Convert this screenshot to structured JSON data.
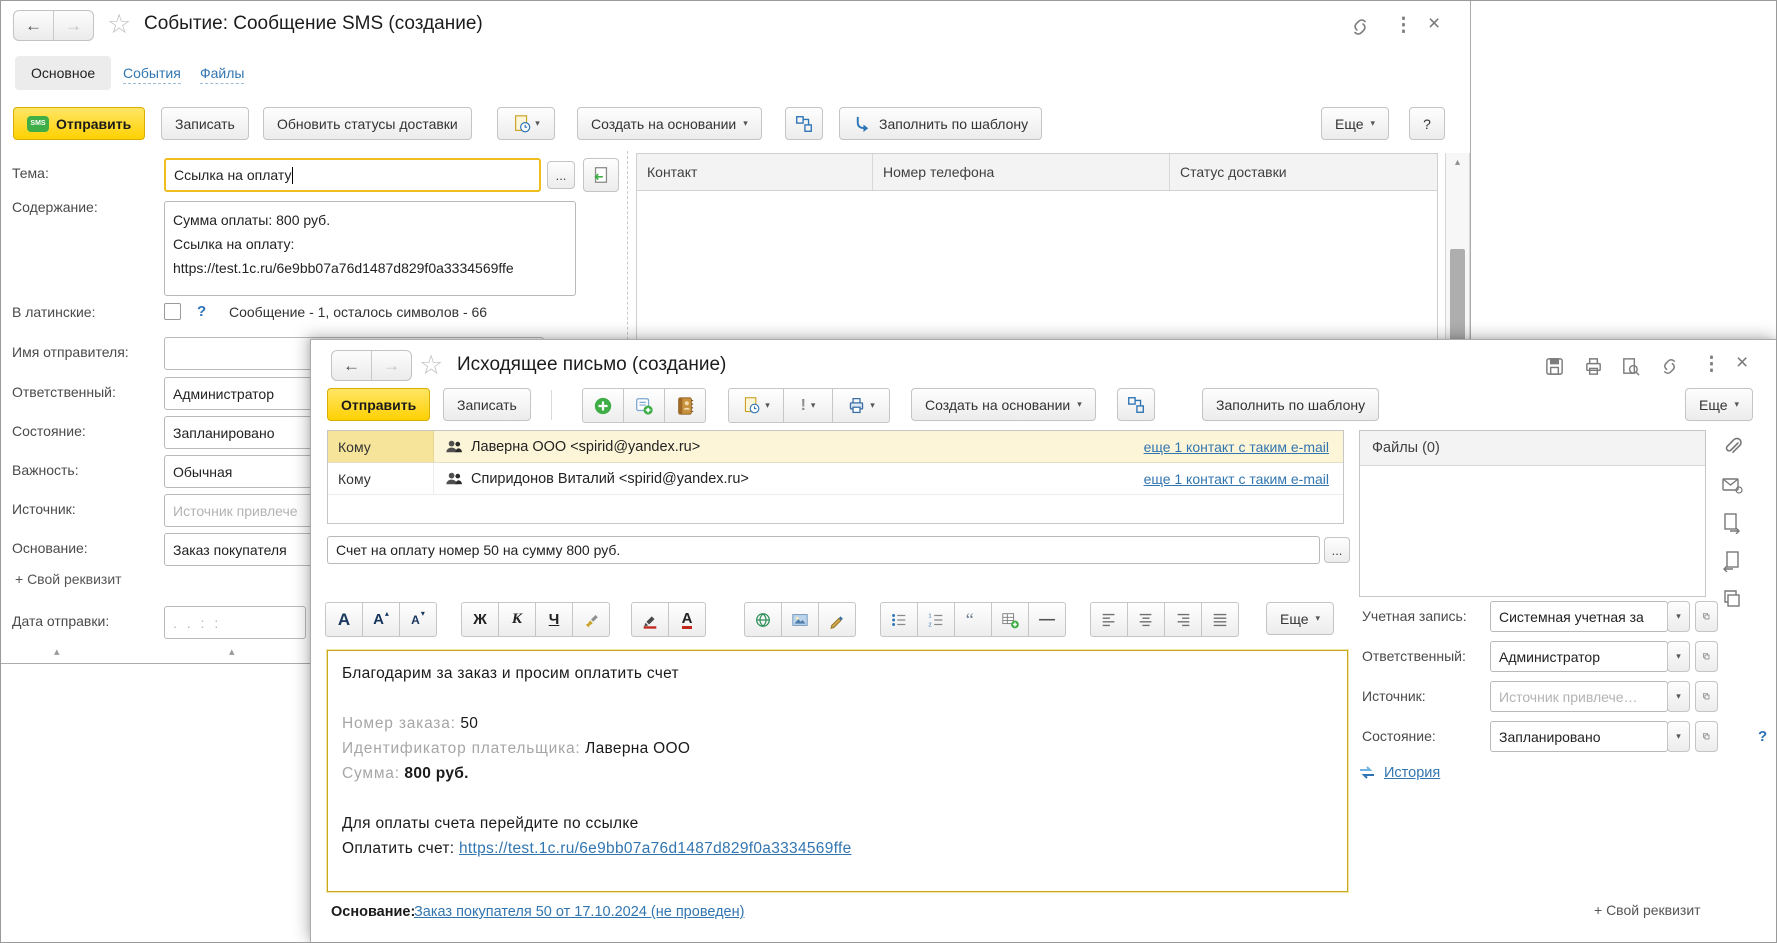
{
  "sms": {
    "title": "Событие: Сообщение SMS (создание)",
    "tabs": [
      "Основное",
      "События",
      "Файлы"
    ],
    "toolbar": {
      "send": "Отправить",
      "send_badge": "SMS",
      "save": "Записать",
      "update_status": "Обновить статусы доставки",
      "create_from": "Создать на основании",
      "fill_template": "Заполнить по шаблону",
      "more": "Еще",
      "help": "?"
    },
    "form": {
      "theme_label": "Тема:",
      "theme_value": "Ссылка на оплату",
      "ellipsis": "...",
      "content_label": "Содержание:",
      "content_value": "Сумма оплаты: 800 руб.\nСсылка на оплату:\nhttps://test.1c.ru/6e9bb07a76d1487d829f0a3334569ffe",
      "latin_label": "В латинские:",
      "latin_help": "?",
      "latin_info": "Сообщение - 1, осталось символов - 66",
      "sender_label": "Имя отправителя:",
      "responsible_label": "Ответственный:",
      "responsible_value": "Администратор",
      "state_label": "Состояние:",
      "state_value": "Запланировано",
      "importance_label": "Важность:",
      "importance_value": "Обычная",
      "source_label": "Источник:",
      "source_placeholder": "Источник привлече",
      "base_label": "Основание:",
      "base_value": "Заказ покупателя",
      "custom_attribute": "+ Свой реквизит",
      "send_date_label": "Дата отправки:",
      "send_date_placeholder": ". .     : :"
    },
    "contacts": {
      "col_contact": "Контакт",
      "col_phone": "Номер телефона",
      "col_status": "Статус доставки"
    }
  },
  "email": {
    "title": "Исходящее письмо (создание)",
    "toolbar": {
      "send": "Отправить",
      "save": "Записать",
      "create_from": "Создать на основании",
      "fill_template": "Заполнить по шаблону",
      "more": "Еще"
    },
    "recipients": [
      {
        "role": "Кому",
        "contact": "Лаверна ООО <spirid@yandex.ru>",
        "alt": "еще 1 контакт с таким e-mail"
      },
      {
        "role": "Кому",
        "contact": "Спиридонов Виталий  <spirid@yandex.ru>",
        "alt": "еще 1 контакт с таким e-mail"
      }
    ],
    "subject": "Счет на оплату номер 50 на сумму 800 руб.",
    "ellipsis": "...",
    "fmt": {
      "font": "А",
      "bold": "Ж",
      "italic": "К",
      "underline": "Ч",
      "more": "Еще"
    },
    "body": {
      "greeting": "Благодарим за заказ и просим оплатить счет",
      "order_label": "Номер заказа:",
      "order_value": "50",
      "payer_label": "Идентификатор плательщика:",
      "payer_value": "Лаверна ООО",
      "amount_label": "Сумма:",
      "amount_value": "800 руб.",
      "pay_hint": "Для оплаты счета перейдите по ссылке",
      "pay_label": "Оплатить счет:",
      "pay_link": "https://test.1c.ru/6e9bb07a76d1487d829f0a3334569ffe"
    },
    "footer": {
      "base_label": "Основание:",
      "base_link": "Заказ покупателя 50 от 17.10.2024 (не проведен)",
      "custom_attribute": "+ Свой реквизит"
    },
    "panel": {
      "files_title": "Файлы (0)",
      "account_label": "Учетная запись:",
      "account_value": "Системная учетная за",
      "responsible_label": "Ответственный:",
      "responsible_value": "Администратор",
      "source_label": "Источник:",
      "source_placeholder": "Источник привлече…",
      "state_label": "Состояние:",
      "state_value": "Запланировано",
      "state_help": "?",
      "history": "История"
    }
  },
  "colors": {
    "accent_yellow": "#ffd103",
    "link_blue": "#3276b1",
    "row_highlight": "#fdf5d8"
  }
}
